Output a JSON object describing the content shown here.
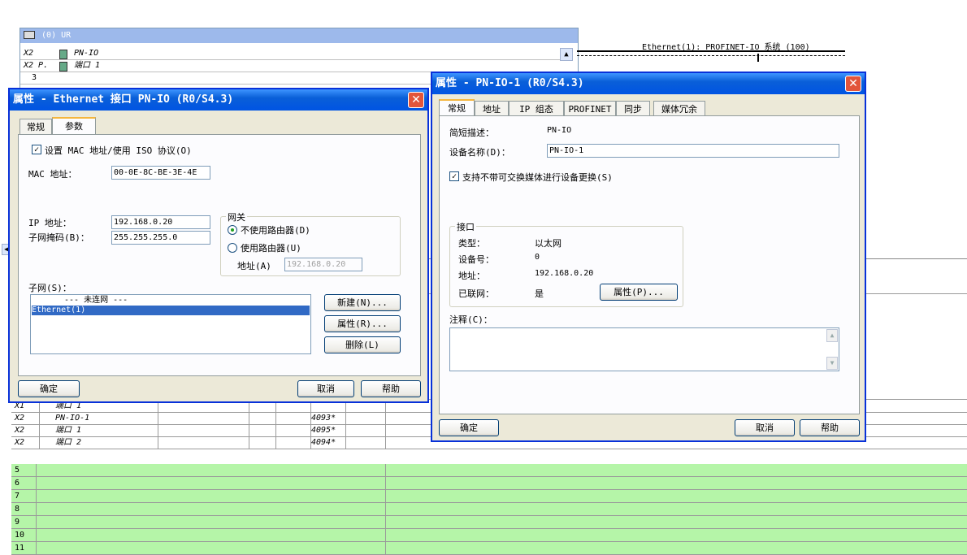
{
  "rack": {
    "title": "(0) UR",
    "rows": [
      {
        "slot": "X2",
        "name": "PN-IO"
      },
      {
        "slot": "X2 P.",
        "name": "端口 1"
      },
      {
        "slot": "3",
        "name": ""
      }
    ]
  },
  "network": {
    "label": "Ethernet(1): PROFINET-IO 系统 (100)"
  },
  "table": {
    "rows": [
      {
        "slot": "X1",
        "module": "端口 1",
        "addr": ""
      },
      {
        "slot": "X2",
        "module": "PN-IO-1",
        "addr": "4093*"
      },
      {
        "slot": "X2",
        "module": "端口 1",
        "addr": "4095*"
      },
      {
        "slot": "X2",
        "module": "端口 2",
        "addr": "4094*"
      }
    ],
    "empty_rows": [
      "5",
      "6",
      "7",
      "8",
      "9",
      "10",
      "11"
    ]
  },
  "dlg1": {
    "title": "属性 - Ethernet 接口  PN-IO (R0/S4.3)",
    "tabs": [
      "常规",
      "参数"
    ],
    "chk_mac": "设置 MAC 地址/使用 ISO 协议(O)",
    "mac_label": "MAC 地址：",
    "mac_value": "00-0E-8C-BE-3E-4E",
    "ip_label": "IP 地址：",
    "ip_value": "192.168.0.20",
    "mask_label": "子网掩码(B)：",
    "mask_value": "255.255.255.0",
    "gateway_label": "网关",
    "radio_no_router": "不使用路由器(D)",
    "radio_router": "使用路由器(U)",
    "gw_addr_label": "地址(A)",
    "gw_addr_value": "192.168.0.20",
    "subnet_label": "子网(S)：",
    "subnets": [
      "--- 未连网 ---",
      "Ethernet(1)"
    ],
    "btn_new": "新建(N)...",
    "btn_props": "属性(R)...",
    "btn_delete": "删除(L)",
    "btn_ok": "确定",
    "btn_cancel": "取消",
    "btn_help": "帮助"
  },
  "dlg2": {
    "title": "属性 - PN-IO-1 (R0/S4.3)",
    "tabs": [
      "常规",
      "地址",
      "IP 组态",
      "PROFINET",
      "同步",
      "媒体冗余"
    ],
    "short_desc_label": "简短描述：",
    "short_desc_value": "PN-IO",
    "device_name_label": "设备名称(D)：",
    "device_name_value": "PN-IO-1",
    "chk_replace": "支持不带可交换媒体进行设备更换(S)",
    "iface_group": "接口",
    "type_label": "类型：",
    "type_value": "以太网",
    "devno_label": "设备号：",
    "devno_value": "0",
    "addr_label": "地址：",
    "addr_value": "192.168.0.20",
    "networked_label": "已联网：",
    "networked_value": "是",
    "btn_props": "属性(P)...",
    "comment_label": "注释(C)：",
    "btn_ok": "确定",
    "btn_cancel": "取消",
    "btn_help": "帮助"
  }
}
